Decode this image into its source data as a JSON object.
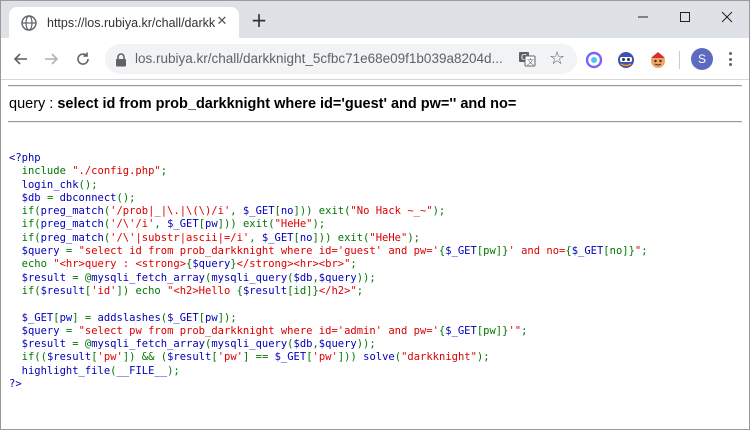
{
  "browser": {
    "tab_title": "https://los.rubiya.kr/chall/darkkn",
    "url": "los.rubiya.kr/chall/darkknight_5cfbc71e68e09f1b039a8204d...",
    "profile_initial": "S"
  },
  "page": {
    "query_label": "query : ",
    "query_text": "select id from prob_darkknight where id='guest' and pw='' and no="
  },
  "source_code": [
    [
      {
        "t": "<?php",
        "c": "def"
      }
    ],
    [
      {
        "t": "  include ",
        "c": "kw"
      },
      {
        "t": "\"./config.php\"",
        "c": "str"
      },
      {
        "t": ";",
        "c": "kw"
      }
    ],
    [
      {
        "t": "  login_chk",
        "c": "def"
      },
      {
        "t": "();",
        "c": "kw"
      }
    ],
    [
      {
        "t": "  $db ",
        "c": "def"
      },
      {
        "t": "= ",
        "c": "kw"
      },
      {
        "t": "dbconnect",
        "c": "def"
      },
      {
        "t": "();",
        "c": "kw"
      }
    ],
    [
      {
        "t": "  if(",
        "c": "kw"
      },
      {
        "t": "preg_match",
        "c": "def"
      },
      {
        "t": "(",
        "c": "kw"
      },
      {
        "t": "'/prob|_|\\.|\\(\\)/i'",
        "c": "str"
      },
      {
        "t": ", ",
        "c": "kw"
      },
      {
        "t": "$_GET",
        "c": "def"
      },
      {
        "t": "[",
        "c": "kw"
      },
      {
        "t": "no",
        "c": "def"
      },
      {
        "t": "])) exit(",
        "c": "kw"
      },
      {
        "t": "\"No Hack ~_~\"",
        "c": "str"
      },
      {
        "t": ");",
        "c": "kw"
      }
    ],
    [
      {
        "t": "  if(",
        "c": "kw"
      },
      {
        "t": "preg_match",
        "c": "def"
      },
      {
        "t": "(",
        "c": "kw"
      },
      {
        "t": "'/\\'/i'",
        "c": "str"
      },
      {
        "t": ", ",
        "c": "kw"
      },
      {
        "t": "$_GET",
        "c": "def"
      },
      {
        "t": "[",
        "c": "kw"
      },
      {
        "t": "pw",
        "c": "def"
      },
      {
        "t": "])) exit(",
        "c": "kw"
      },
      {
        "t": "\"HeHe\"",
        "c": "str"
      },
      {
        "t": ");",
        "c": "kw"
      }
    ],
    [
      {
        "t": "  if(",
        "c": "kw"
      },
      {
        "t": "preg_match",
        "c": "def"
      },
      {
        "t": "(",
        "c": "kw"
      },
      {
        "t": "'/\\'|substr|ascii|=/i'",
        "c": "str"
      },
      {
        "t": ", ",
        "c": "kw"
      },
      {
        "t": "$_GET",
        "c": "def"
      },
      {
        "t": "[",
        "c": "kw"
      },
      {
        "t": "no",
        "c": "def"
      },
      {
        "t": "])) exit(",
        "c": "kw"
      },
      {
        "t": "\"HeHe\"",
        "c": "str"
      },
      {
        "t": ");",
        "c": "kw"
      }
    ],
    [
      {
        "t": "  $query ",
        "c": "def"
      },
      {
        "t": "= ",
        "c": "kw"
      },
      {
        "t": "\"select id from prob_darkknight where id='guest' and pw='",
        "c": "str"
      },
      {
        "t": "{",
        "c": "kw"
      },
      {
        "t": "$_GET",
        "c": "def"
      },
      {
        "t": "[pw]",
        "c": "kw"
      },
      {
        "t": "}",
        "c": "kw"
      },
      {
        "t": "' and no=",
        "c": "str"
      },
      {
        "t": "{",
        "c": "kw"
      },
      {
        "t": "$_GET",
        "c": "def"
      },
      {
        "t": "[no]",
        "c": "kw"
      },
      {
        "t": "}",
        "c": "kw"
      },
      {
        "t": "\"",
        "c": "str"
      },
      {
        "t": ";",
        "c": "kw"
      }
    ],
    [
      {
        "t": "  echo ",
        "c": "kw"
      },
      {
        "t": "\"<hr>query : <strong>",
        "c": "str"
      },
      {
        "t": "{",
        "c": "kw"
      },
      {
        "t": "$query",
        "c": "def"
      },
      {
        "t": "}",
        "c": "kw"
      },
      {
        "t": "</strong><hr><br>\"",
        "c": "str"
      },
      {
        "t": ";",
        "c": "kw"
      }
    ],
    [
      {
        "t": "  $result ",
        "c": "def"
      },
      {
        "t": "= @",
        "c": "kw"
      },
      {
        "t": "mysqli_fetch_array",
        "c": "def"
      },
      {
        "t": "(",
        "c": "kw"
      },
      {
        "t": "mysqli_query",
        "c": "def"
      },
      {
        "t": "(",
        "c": "kw"
      },
      {
        "t": "$db",
        "c": "def"
      },
      {
        "t": ",",
        "c": "kw"
      },
      {
        "t": "$query",
        "c": "def"
      },
      {
        "t": "));",
        "c": "kw"
      }
    ],
    [
      {
        "t": "  if(",
        "c": "kw"
      },
      {
        "t": "$result",
        "c": "def"
      },
      {
        "t": "[",
        "c": "kw"
      },
      {
        "t": "'id'",
        "c": "str"
      },
      {
        "t": "]) echo ",
        "c": "kw"
      },
      {
        "t": "\"<h2>Hello ",
        "c": "str"
      },
      {
        "t": "{",
        "c": "kw"
      },
      {
        "t": "$result",
        "c": "def"
      },
      {
        "t": "[id]",
        "c": "kw"
      },
      {
        "t": "}",
        "c": "kw"
      },
      {
        "t": "</h2>\"",
        "c": "str"
      },
      {
        "t": ";",
        "c": "kw"
      }
    ],
    [],
    [
      {
        "t": "  $_GET",
        "c": "def"
      },
      {
        "t": "[",
        "c": "kw"
      },
      {
        "t": "pw",
        "c": "def"
      },
      {
        "t": "] = ",
        "c": "kw"
      },
      {
        "t": "addslashes",
        "c": "def"
      },
      {
        "t": "(",
        "c": "kw"
      },
      {
        "t": "$_GET",
        "c": "def"
      },
      {
        "t": "[",
        "c": "kw"
      },
      {
        "t": "pw",
        "c": "def"
      },
      {
        "t": "]);",
        "c": "kw"
      }
    ],
    [
      {
        "t": "  $query ",
        "c": "def"
      },
      {
        "t": "= ",
        "c": "kw"
      },
      {
        "t": "\"select pw from prob_darkknight where id='admin' and pw='",
        "c": "str"
      },
      {
        "t": "{",
        "c": "kw"
      },
      {
        "t": "$_GET",
        "c": "def"
      },
      {
        "t": "[pw]",
        "c": "kw"
      },
      {
        "t": "}",
        "c": "kw"
      },
      {
        "t": "'\"",
        "c": "str"
      },
      {
        "t": ";",
        "c": "kw"
      }
    ],
    [
      {
        "t": "  $result ",
        "c": "def"
      },
      {
        "t": "= @",
        "c": "kw"
      },
      {
        "t": "mysqli_fetch_array",
        "c": "def"
      },
      {
        "t": "(",
        "c": "kw"
      },
      {
        "t": "mysqli_query",
        "c": "def"
      },
      {
        "t": "(",
        "c": "kw"
      },
      {
        "t": "$db",
        "c": "def"
      },
      {
        "t": ",",
        "c": "kw"
      },
      {
        "t": "$query",
        "c": "def"
      },
      {
        "t": "));",
        "c": "kw"
      }
    ],
    [
      {
        "t": "  if((",
        "c": "kw"
      },
      {
        "t": "$result",
        "c": "def"
      },
      {
        "t": "[",
        "c": "kw"
      },
      {
        "t": "'pw'",
        "c": "str"
      },
      {
        "t": "]) && (",
        "c": "kw"
      },
      {
        "t": "$result",
        "c": "def"
      },
      {
        "t": "[",
        "c": "kw"
      },
      {
        "t": "'pw'",
        "c": "str"
      },
      {
        "t": "] == ",
        "c": "kw"
      },
      {
        "t": "$_GET",
        "c": "def"
      },
      {
        "t": "[",
        "c": "kw"
      },
      {
        "t": "'pw'",
        "c": "str"
      },
      {
        "t": "])) ",
        "c": "kw"
      },
      {
        "t": "solve",
        "c": "def"
      },
      {
        "t": "(",
        "c": "kw"
      },
      {
        "t": "\"darkknight\"",
        "c": "str"
      },
      {
        "t": ");",
        "c": "kw"
      }
    ],
    [
      {
        "t": "  highlight_file",
        "c": "def"
      },
      {
        "t": "(",
        "c": "kw"
      },
      {
        "t": "__FILE__",
        "c": "def"
      },
      {
        "t": ");",
        "c": "kw"
      }
    ],
    [
      {
        "t": "?>",
        "c": "def"
      }
    ]
  ]
}
